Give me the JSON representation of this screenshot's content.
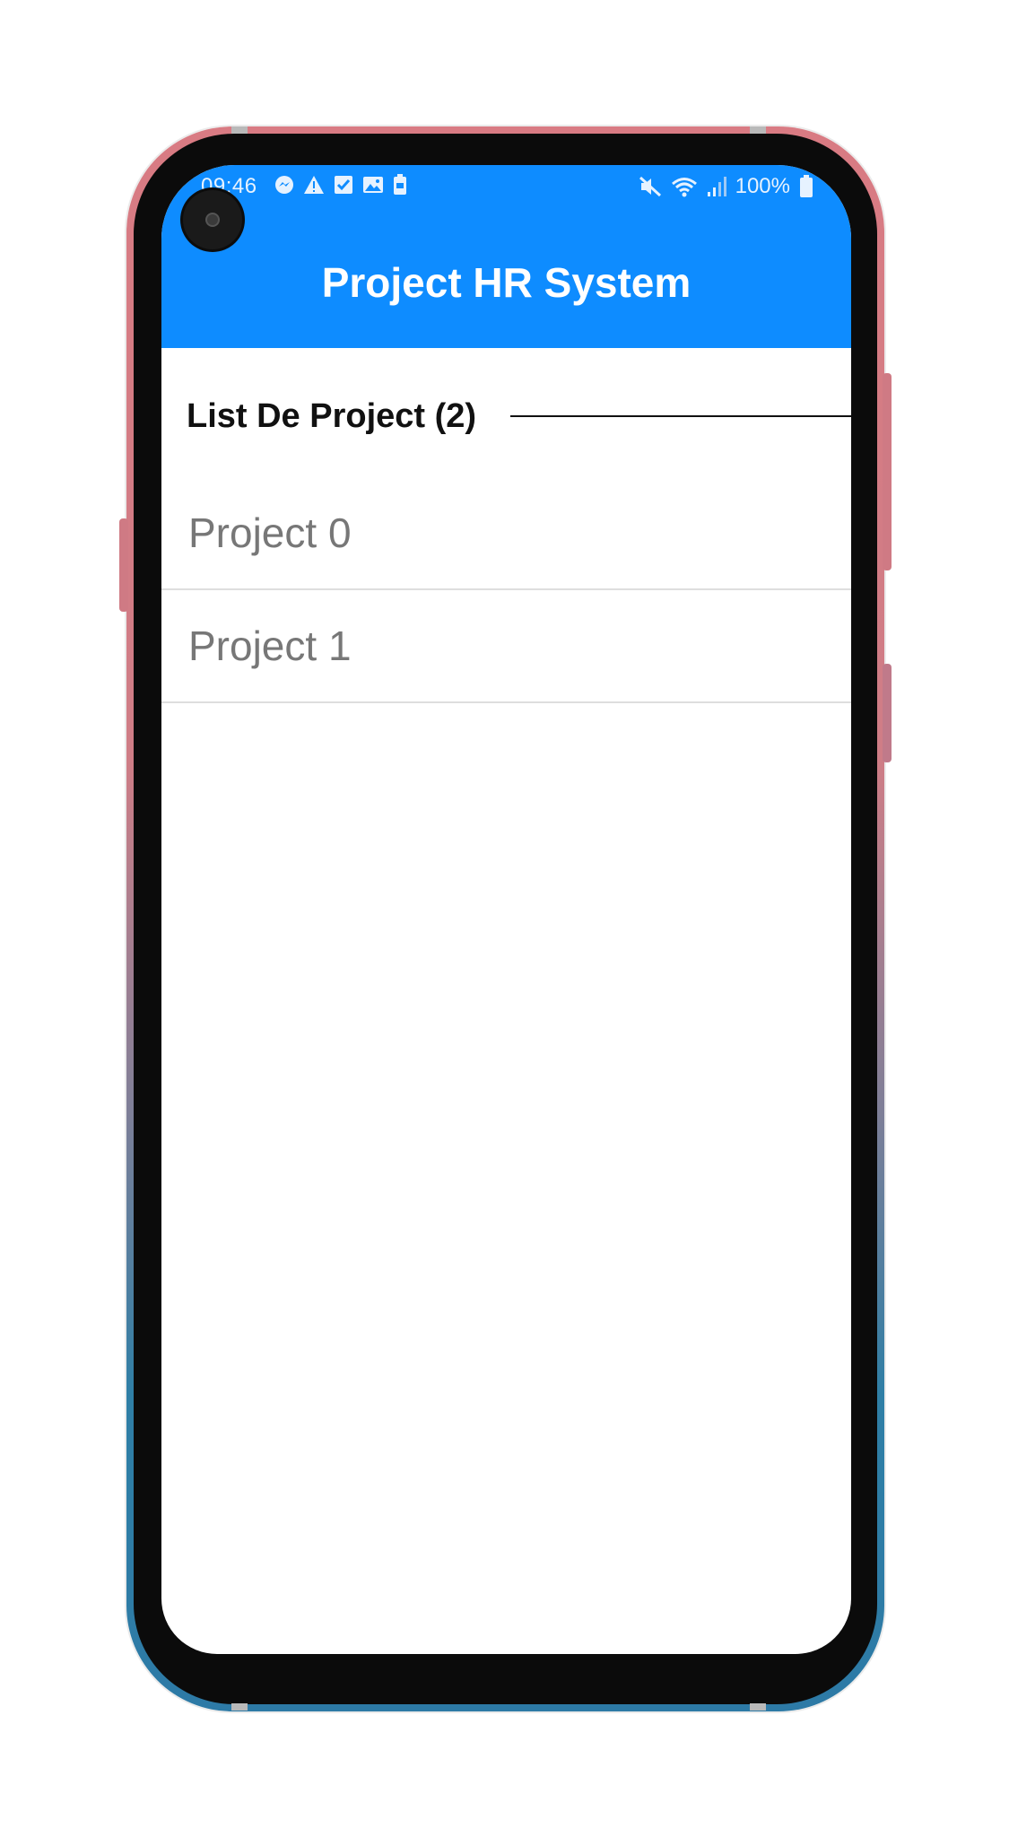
{
  "status_bar": {
    "time": "09:46",
    "battery": "100%",
    "left_icons": [
      "messenger-icon",
      "warning-icon",
      "check-icon",
      "image-icon",
      "battery-saver-icon"
    ],
    "right_icons": [
      "mute-icon",
      "wifi-icon",
      "signal-icon",
      "battery-icon"
    ]
  },
  "app": {
    "title": "Project HR System",
    "accent_color": "#0e8cff"
  },
  "section": {
    "title": "List De Project (2)"
  },
  "projects": [
    {
      "label": "Project 0"
    },
    {
      "label": "Project 1"
    }
  ]
}
